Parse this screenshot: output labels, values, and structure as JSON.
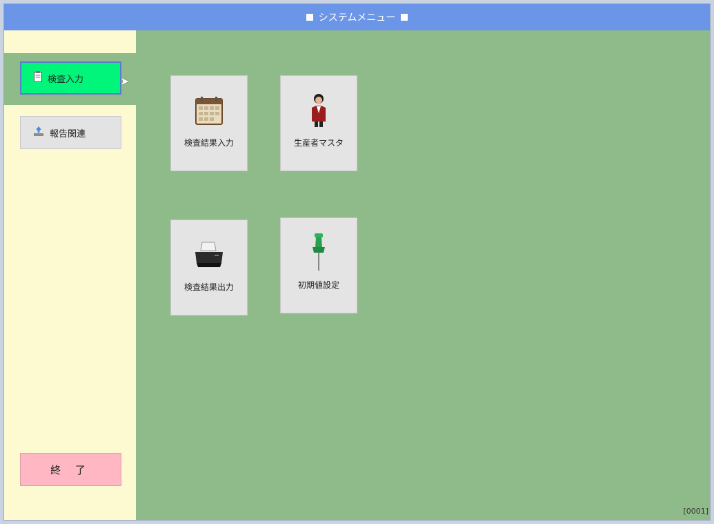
{
  "window": {
    "title": "システムメニュー",
    "screen_code": "[0001]"
  },
  "sidebar": {
    "items": [
      {
        "label": "検査入力",
        "icon": "clipboard-icon",
        "active": true
      },
      {
        "label": "報告関連",
        "icon": "upload-tray-icon",
        "active": false
      }
    ],
    "exit_label": "終 了"
  },
  "main": {
    "tiles": [
      {
        "label": "検査結果入力",
        "icon": "calendar-icon"
      },
      {
        "label": "生産者マスタ",
        "icon": "person-icon"
      },
      {
        "label": "検査結果出力",
        "icon": "printer-icon"
      },
      {
        "label": "初期値設定",
        "icon": "pushpin-icon"
      }
    ]
  },
  "colors": {
    "titlebar": "#6b96e8",
    "content_bg": "#8fbb8a",
    "sidebar_bg": "#fdf9d0",
    "active_nav": "#00f57a",
    "exit_button": "#ffb7c3",
    "tile_bg": "#e4e4e4"
  }
}
